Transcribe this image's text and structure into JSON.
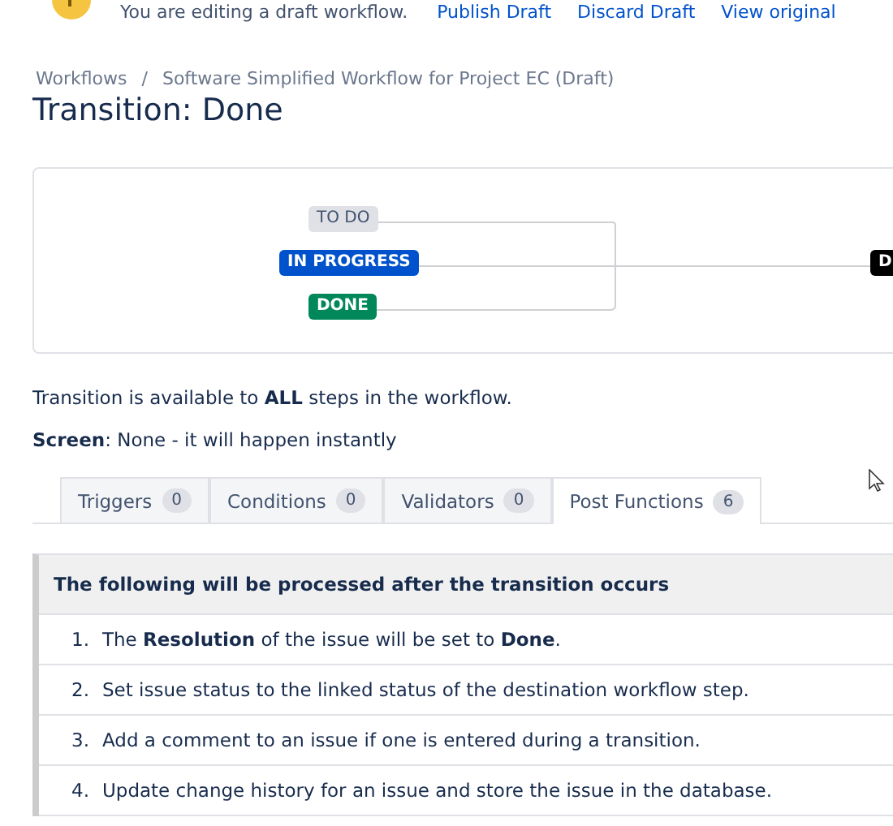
{
  "banner": {
    "message": "You are editing a draft workflow.",
    "links": [
      "Publish Draft",
      "Discard Draft",
      "View original"
    ]
  },
  "breadcrumbs": [
    "Workflows",
    "Software Simplified Workflow for Project EC (Draft)"
  ],
  "breadcrumb_separator": "/",
  "title": "Transition: Done",
  "diagram": {
    "sources": [
      {
        "label": "TO DO",
        "kind": "todo"
      },
      {
        "label": "IN PROGRESS",
        "kind": "inprogress"
      },
      {
        "label": "DONE",
        "kind": "done"
      }
    ],
    "target": {
      "label": "D"
    }
  },
  "availability": "Transition is available to **ALL** steps in the workflow.",
  "screen": "**Screen**: None - it will happen instantly",
  "tabs": [
    {
      "label": "Triggers",
      "count": "0",
      "selected": false
    },
    {
      "label": "Conditions",
      "count": "0",
      "selected": false
    },
    {
      "label": "Validators",
      "count": "0",
      "selected": false
    },
    {
      "label": "Post Functions",
      "count": "6",
      "selected": true
    }
  ],
  "panel": {
    "heading": "The following will be processed after the transition occurs",
    "items": [
      {
        "number": "1.",
        "text": "The **Resolution** of the issue will be set to **Done**."
      },
      {
        "number": "2.",
        "text": "Set issue status to the linked status of the destination workflow step."
      },
      {
        "number": "3.",
        "text": "Add a comment to an issue if one is entered during a transition."
      },
      {
        "number": "4.",
        "text": "Update change history for an issue and store the issue in the database."
      }
    ]
  }
}
